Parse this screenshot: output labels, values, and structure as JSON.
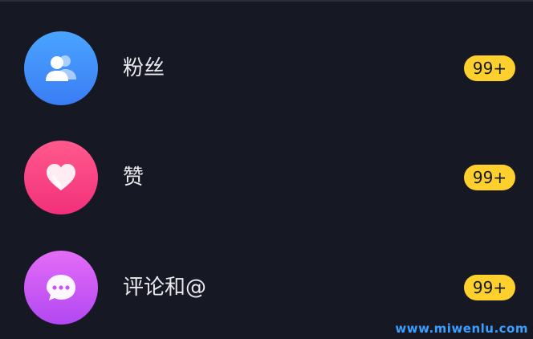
{
  "notifications": {
    "items": [
      {
        "key": "fans",
        "icon": "users-icon",
        "label": "粉丝",
        "badge": "99+"
      },
      {
        "key": "likes",
        "icon": "heart-icon",
        "label": "赞",
        "badge": "99+"
      },
      {
        "key": "comments",
        "icon": "chat-bubble-icon",
        "label": "评论和@",
        "badge": "99+"
      }
    ]
  },
  "watermark": {
    "text": "www.miwenlu.com"
  },
  "colors": {
    "background": "#161823",
    "badge": "#fdd02d",
    "fans_avatar": "#3a8af8",
    "likes_avatar": "#f6407f",
    "comments_avatar": "#c656f4",
    "watermark": "#3aa0ff"
  }
}
